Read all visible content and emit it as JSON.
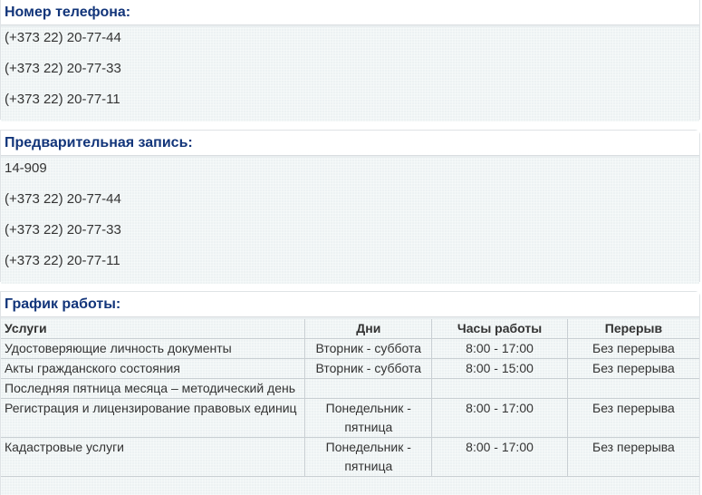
{
  "phone": {
    "title": "Номер телефона:",
    "numbers": [
      "(+373 22) 20-77-44",
      "(+373 22) 20-77-33",
      "(+373 22) 20-77-11"
    ]
  },
  "booking": {
    "title": "Предварительная запись:",
    "numbers": [
      "14-909",
      "(+373 22) 20-77-44",
      "(+373 22) 20-77-33",
      "(+373 22) 20-77-11"
    ]
  },
  "schedule": {
    "title": "График работы:",
    "headers": [
      "Услуги",
      "Дни",
      "Часы работы",
      "Перерыв"
    ],
    "rows": [
      [
        "Удостоверяющие личность документы",
        "Вторник - суббота",
        "8:00 - 17:00",
        "Без перерыва"
      ],
      [
        "Акты гражданского состояния",
        "Вторник - суббота",
        "8:00 - 15:00",
        "Без перерыва"
      ],
      [
        "Последняя пятница месяца – методический день",
        "",
        "",
        ""
      ],
      [
        "Регистрация и лицензирование правовых единиц",
        "Понедельник - пятница",
        "8:00 - 17:00",
        "Без перерыва"
      ],
      [
        "Кадастровые услуги",
        "Понедельник - пятница",
        "8:00 - 17:00",
        "Без перерыва"
      ]
    ]
  }
}
